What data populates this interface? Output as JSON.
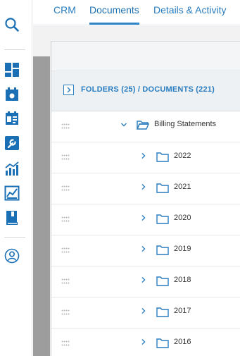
{
  "nav": {
    "icons": [
      "search-icon",
      "dashboard-icon",
      "calendar-icon",
      "contacts-icon",
      "tools-icon",
      "reports-icon",
      "analytics-icon",
      "library-icon",
      "user-icon"
    ]
  },
  "tabs": [
    {
      "label": "CRM",
      "active": false
    },
    {
      "label": "Documents",
      "active": true
    },
    {
      "label": "Details & Activity",
      "active": false
    }
  ],
  "breadcrumb": {
    "text": "FOLDERS (25) / DOCUMENTS (221)"
  },
  "tree": {
    "root": {
      "label": "Billing Statements",
      "expanded": true
    },
    "children": [
      {
        "label": "2022",
        "expanded": false
      },
      {
        "label": "2021",
        "expanded": false
      },
      {
        "label": "2020",
        "expanded": false
      },
      {
        "label": "2019",
        "expanded": false
      },
      {
        "label": "2018",
        "expanded": false
      },
      {
        "label": "2017",
        "expanded": false
      },
      {
        "label": "2016",
        "expanded": false
      }
    ]
  },
  "colors": {
    "accent": "#2a7dbf",
    "rail_icon": "#1a6fb5",
    "tab_underline": "#2f86c8"
  }
}
